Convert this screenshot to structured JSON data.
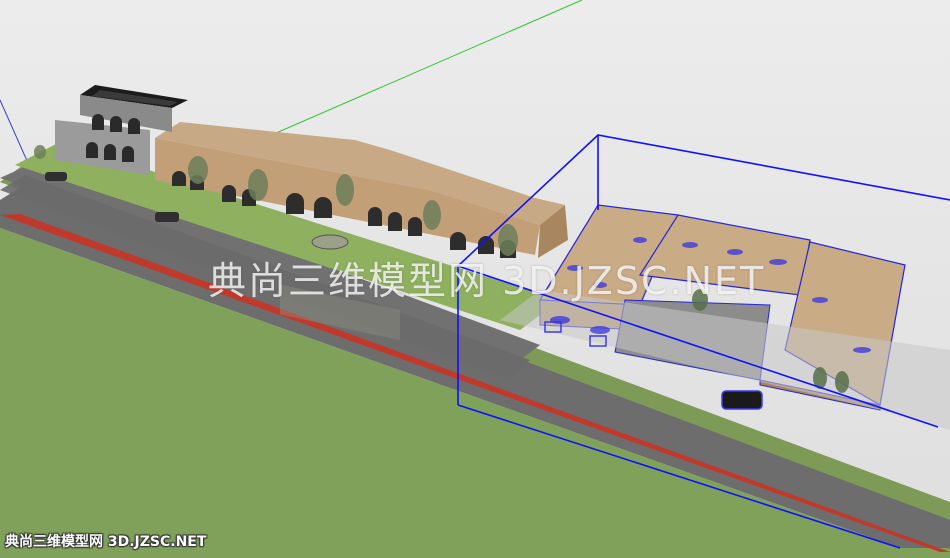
{
  "viewport": {
    "background_color": "#e6e6e6",
    "ground_color": "#7d9a57",
    "road_color": "#6d6d6d",
    "facade_color": "#c9ab86",
    "selection_color": "#0000ff",
    "green_axis_color": "#2ec42e",
    "red_axis_color": "#d9534f"
  },
  "watermark": {
    "center_text": "典尚三维模型网 3D.JZSC.NET",
    "footer_text": "典尚三维模型网 3D.JZSC.NET"
  }
}
